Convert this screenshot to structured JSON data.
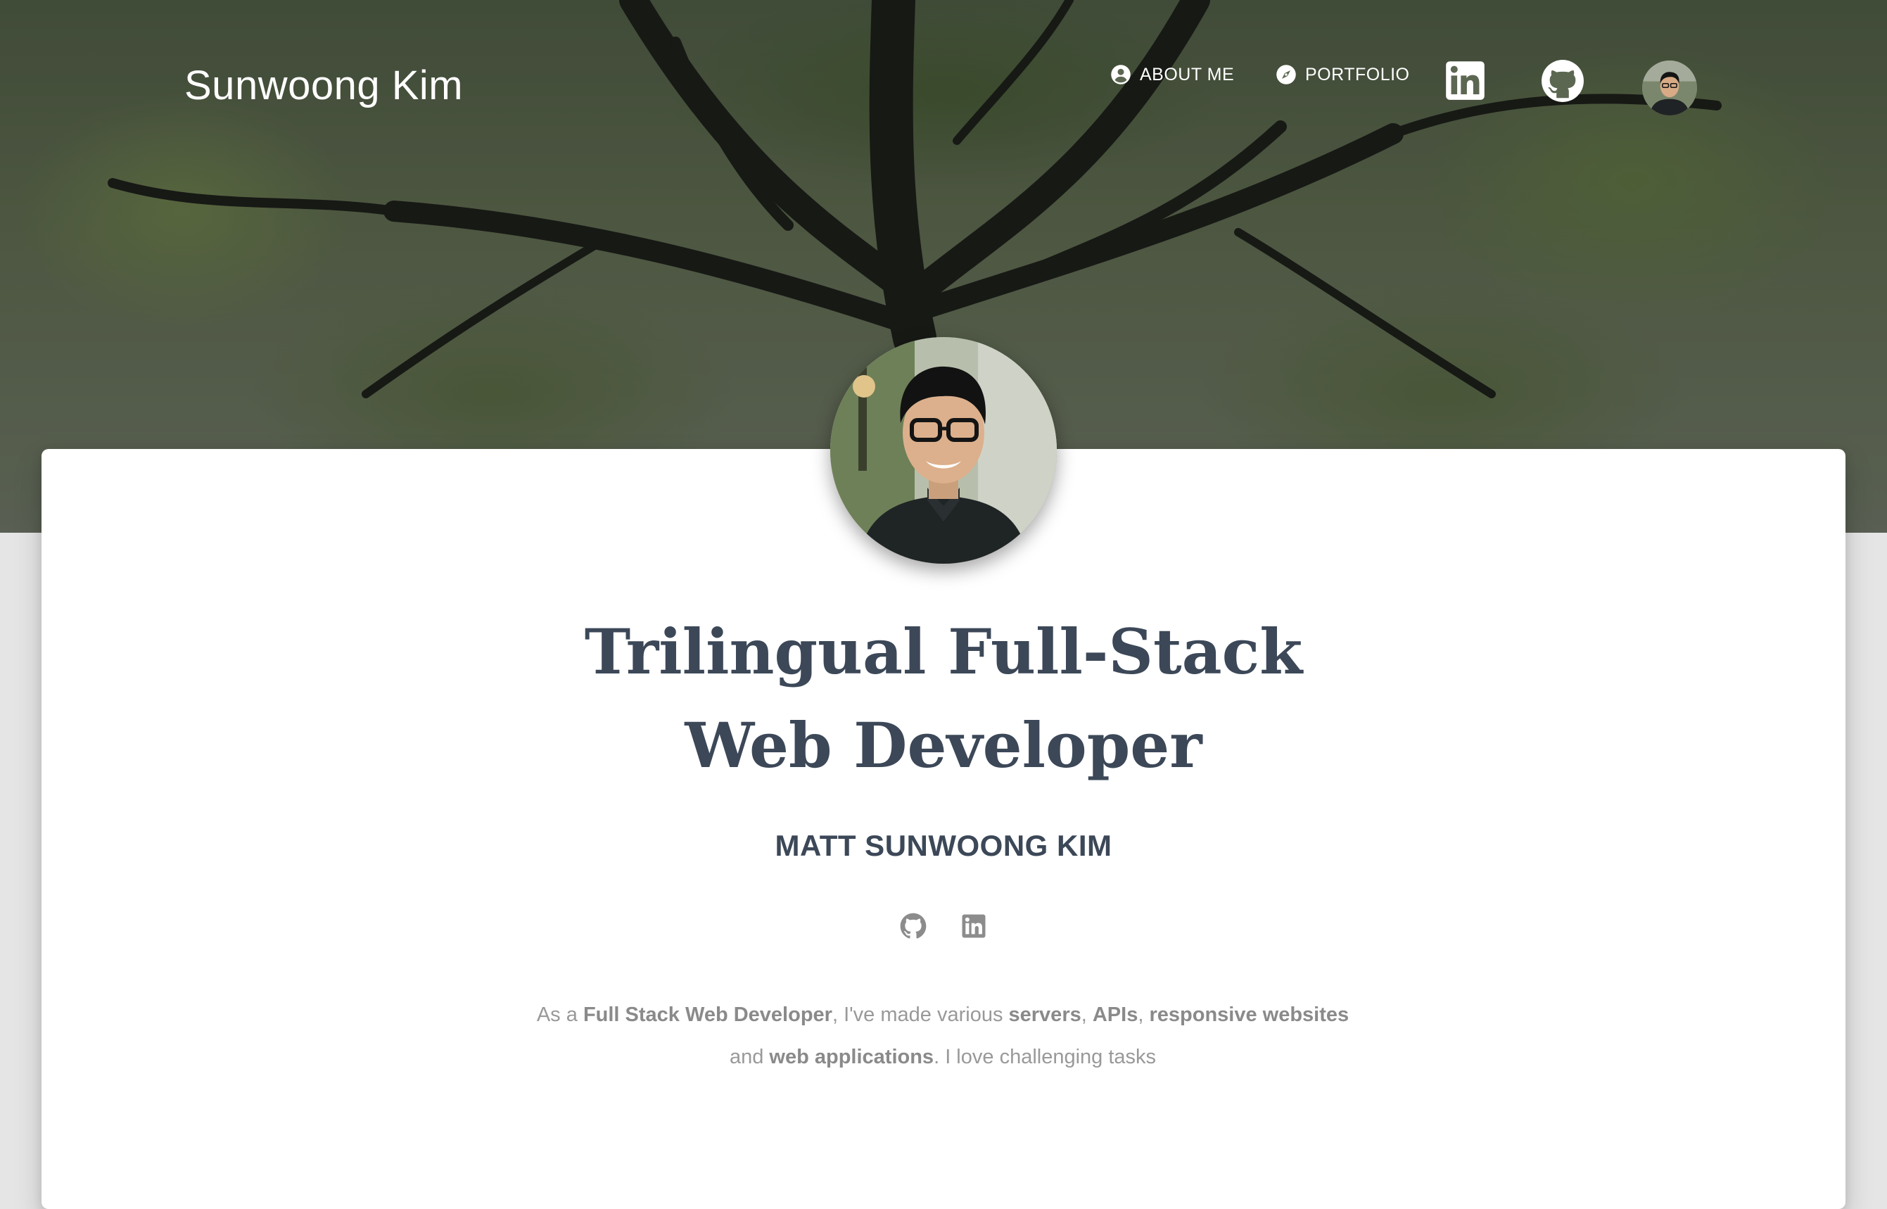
{
  "brand": "Sunwoong Kim",
  "nav": {
    "about": "ABOUT ME",
    "portfolio": "PORTFOLIO"
  },
  "icons": {
    "about": "account-circle-icon",
    "portfolio": "compass-icon",
    "linkedin": "linkedin-icon",
    "github": "github-icon"
  },
  "hero": {
    "title_line1": "Trilingual Full-Stack",
    "title_line2": "Web Developer",
    "name": "MATT SUNWOONG KIM"
  },
  "description": {
    "p1": "As a ",
    "b1": "Full Stack Web Developer",
    "p2": ", I've made various ",
    "b2": "servers",
    "p3": ", ",
    "b3": "APIs",
    "p4": ", ",
    "b4": "responsive websites",
    "p5": " and ",
    "b5": "web applications",
    "p6": ". I love challenging tasks"
  },
  "colors": {
    "heading": "#3c4858",
    "muted_text": "#999999",
    "icon_gray": "#8c8c8c",
    "card": "#ffffff",
    "page_bg": "#e5e5e5"
  }
}
